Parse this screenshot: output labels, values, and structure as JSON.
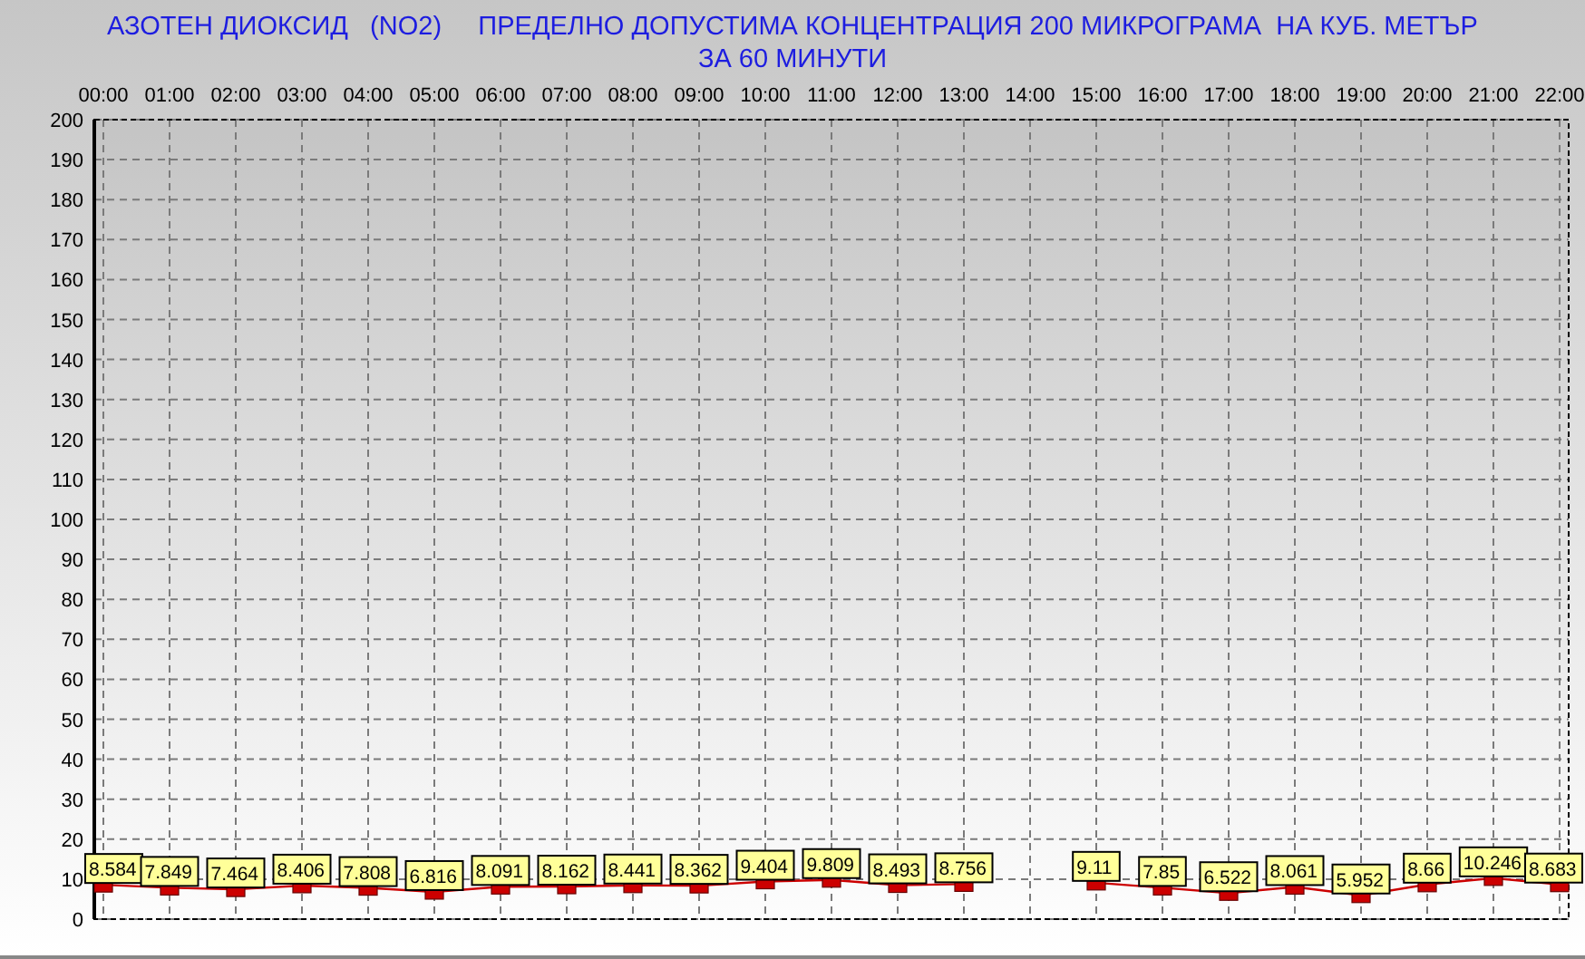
{
  "chart_data": {
    "type": "line",
    "title": "АЗОТЕН ДИОКСИД   (NO2)     ПРЕДЕЛНО ДОПУСТИМА КОНЦЕНТРАЦИЯ 200 МИКРОГРАМА  НА КУБ. МЕТЪР\nЗА 60 МИНУТИ",
    "categories": [
      "00:00",
      "01:00",
      "02:00",
      "03:00",
      "04:00",
      "05:00",
      "06:00",
      "07:00",
      "08:00",
      "09:00",
      "10:00",
      "11:00",
      "12:00",
      "13:00",
      "14:00",
      "15:00",
      "16:00",
      "17:00",
      "18:00",
      "19:00",
      "20:00",
      "21:00",
      "22:00"
    ],
    "values": [
      8.584,
      7.849,
      7.464,
      8.406,
      7.808,
      6.816,
      8.091,
      8.162,
      8.441,
      8.362,
      9.404,
      9.809,
      8.493,
      8.756,
      null,
      9.11,
      7.85,
      6.522,
      8.061,
      5.952,
      8.66,
      10.246,
      8.683
    ],
    "ylim": [
      0,
      200
    ],
    "yticks": [
      0,
      10,
      20,
      30,
      40,
      50,
      60,
      70,
      80,
      90,
      100,
      110,
      120,
      130,
      140,
      150,
      160,
      170,
      180,
      190,
      200
    ],
    "data_labels": true,
    "grid": true,
    "marker": true
  }
}
